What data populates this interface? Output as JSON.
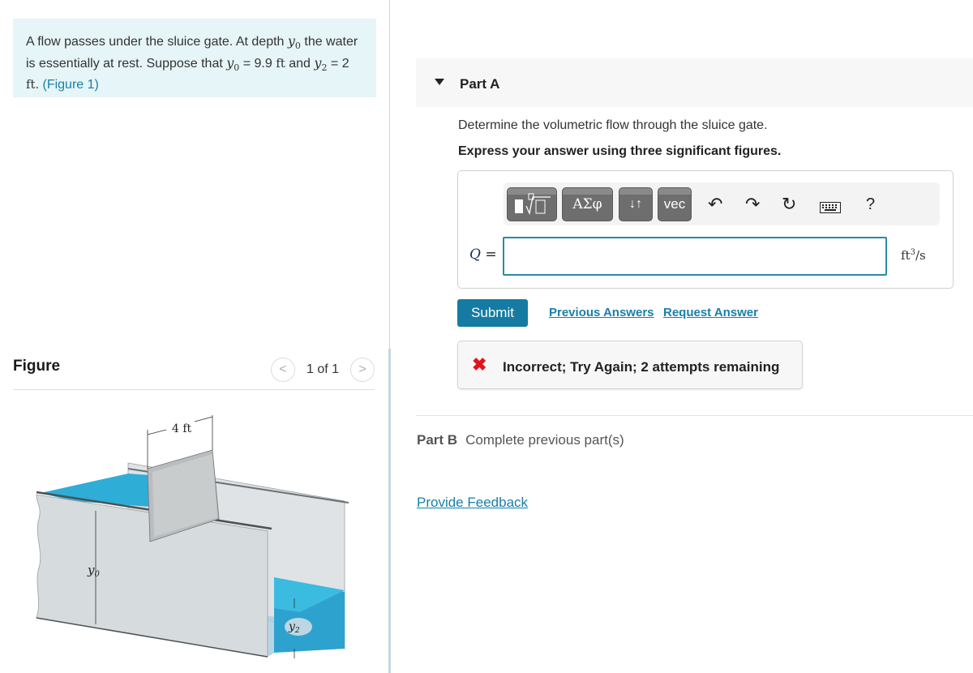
{
  "intro": {
    "t1": "A flow passes under the sluice gate. At depth ",
    "y0_symbol": "y",
    "y0_sub": "0",
    "t2": " the water is essentially at rest. Suppose that ",
    "t3": " = 9.9 ",
    "unit_ft": "ft",
    "t4": " and ",
    "y2_symbol": "y",
    "y2_sub": "2",
    "t5": " = 2 ",
    "t6": ". ",
    "figure_link": "(Figure 1)"
  },
  "figure": {
    "title": "Figure",
    "pager_text": "1 of 1",
    "prev_glyph": "<",
    "next_glyph": ">",
    "labels": {
      "width": "4 ft",
      "y0": "y",
      "y0_sub": "0",
      "y2": "y",
      "y2_sub": "2"
    },
    "colors": {
      "water": "#2eaed6",
      "channel": "#d8dde0",
      "gate": "#b9bdbf"
    }
  },
  "partA": {
    "title": "Part A",
    "question": "Determine the volumetric flow through the sluice gate.",
    "instruction": "Express your answer using three significant figures.",
    "toolbar": {
      "templates_icon": "templates-icon",
      "greek_label": "ΑΣφ",
      "arrows_label": "↓↑",
      "vec_label": "vec",
      "undo_glyph": "↶",
      "redo_glyph": "↷",
      "reset_glyph": "↻",
      "keyboard_glyph": "⌨",
      "help_glyph": "?"
    },
    "answer": {
      "label_var": "Q",
      "label_eq": " =",
      "value": "",
      "unit_base": "ft",
      "unit_exp": "3",
      "unit_rest": "/s"
    },
    "submit_label": "Submit",
    "previous_answers_label": "Previous Answers",
    "request_answer_label": "Request Answer",
    "feedback": {
      "icon": "✖",
      "text": "Incorrect; Try Again; 2 attempts remaining",
      "icon_color": "#e3131c"
    }
  },
  "partB": {
    "title": "Part B",
    "status": "Complete previous part(s)"
  },
  "provide_feedback_label": "Provide Feedback",
  "colors": {
    "accent": "#157ba2",
    "link": "#197fa8",
    "intro_bg": "#e6f5f7"
  }
}
